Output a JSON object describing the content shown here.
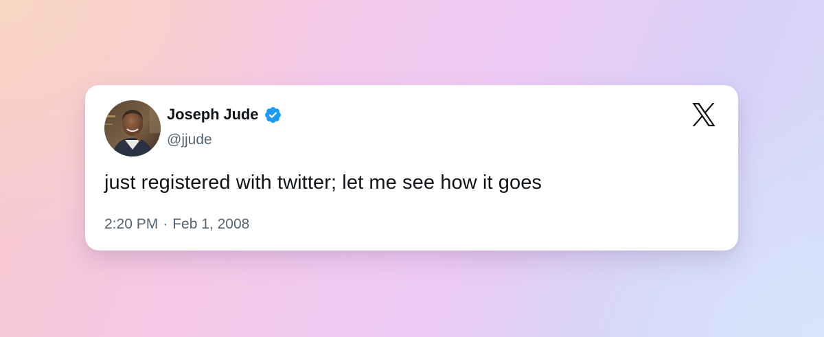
{
  "tweet": {
    "author": {
      "display_name": "Joseph Jude",
      "handle": "@jjude",
      "verified": true,
      "verified_color": "#1d9bf0",
      "avatar_icon": "profile-photo"
    },
    "text": "just registered with twitter; let me see how it goes",
    "time": "2:20 PM",
    "separator": "·",
    "date": "Feb 1, 2008",
    "brand_icon": "x-logo-icon"
  },
  "colors": {
    "text_primary": "#0f1419",
    "text_secondary": "#536471",
    "card_background": "#ffffff"
  }
}
